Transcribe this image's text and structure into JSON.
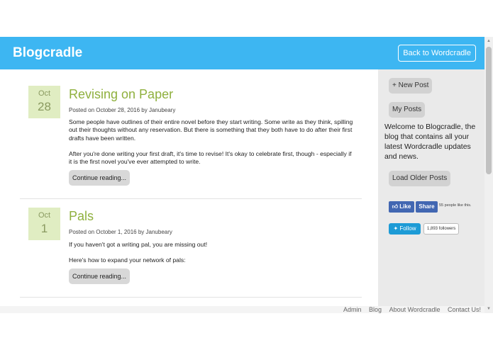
{
  "header": {
    "brand": "Blogcradle",
    "back_button": "Back to Wordcradle"
  },
  "posts": [
    {
      "month": "Oct",
      "day": "28",
      "title": "Revising on Paper",
      "meta": "Posted on October 28, 2016 by Janubeary",
      "paragraphs": [
        "Some people have outlines of their entire novel before they start writing. Some write as they think, spilling out their thoughts without any reservation. But there is something that they both have to do after their first drafts have been written.",
        "After you're done writing your first draft, it's time to revise! It's okay to celebrate first, though - especially if it is the first novel you've ever attempted to write."
      ],
      "continue_label": "Continue reading..."
    },
    {
      "month": "Oct",
      "day": "1",
      "title": "Pals",
      "meta": "Posted on October 1, 2016 by Janubeary",
      "paragraphs": [
        "If you haven't got a writing pal, you are missing out!",
        "Here's how to expand your network of pals:"
      ],
      "continue_label": "Continue reading..."
    }
  ],
  "sidebar": {
    "new_post": "+ New Post",
    "my_posts": "My Posts",
    "welcome": "Welcome to Blogcradle, the blog that contains all your latest Wordcradle updates and news.",
    "load_older": "Load Older Posts",
    "fb_like": "Like",
    "fb_share": "Share",
    "fb_count": "55 people like this.",
    "tw_follow": "Follow",
    "tw_count": "1,893 followers",
    "tw_icon": "twitter-bird-icon",
    "fb_icon": "facebook-thumb-icon"
  },
  "footer": {
    "links": [
      "Admin",
      "Blog",
      "About Wordcradle",
      "Contact Us!"
    ]
  },
  "colors": {
    "header_bg": "#3db6f2",
    "title_green": "#8fb03e",
    "date_bg": "#e0edc2",
    "sidebar_bg": "#eaeaea",
    "facebook_blue": "#4267b2",
    "twitter_blue": "#1d9bd6"
  }
}
